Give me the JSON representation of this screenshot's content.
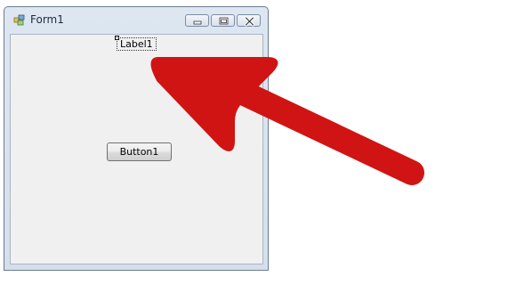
{
  "window": {
    "title": "Form1",
    "app_icon": "form-icon",
    "caption_buttons": [
      "minimize-icon",
      "maximize-icon",
      "close-icon"
    ]
  },
  "form": {
    "label_text": "Label1",
    "button_text": "Button1"
  },
  "annotation": {
    "arrow_icon": "arrow-icon",
    "arrow_color": "#d01414"
  }
}
